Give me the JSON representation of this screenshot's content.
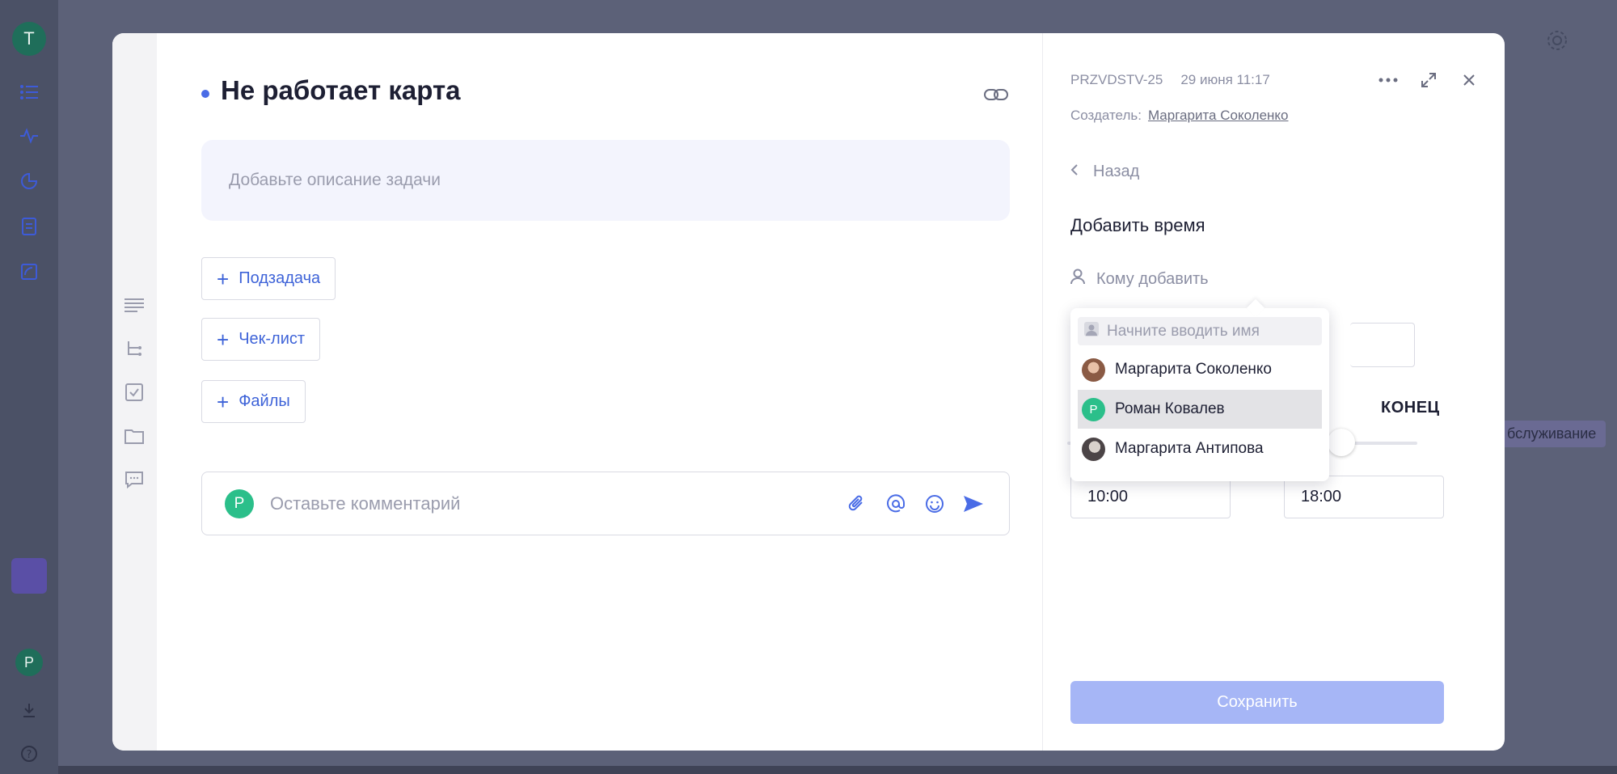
{
  "background": {
    "user_avatar_initial": "Т",
    "bottom_avatar_initial": "Р",
    "chip_text": "бслуживание"
  },
  "task": {
    "title": "Не работает карта",
    "description_placeholder": "Добавьте описание задачи",
    "add_subtask_label": "Подзадача",
    "add_checklist_label": "Чек-лист",
    "add_files_label": "Файлы",
    "comment_avatar_initial": "Р",
    "comment_placeholder": "Оставьте комментарий"
  },
  "details": {
    "task_key": "PRZVDSTV-25",
    "date": "29 июня 11:17",
    "creator_label": "Создатель:",
    "creator_name": "Маргарита Соколенко",
    "back_label": "Назад",
    "section_title": "Добавить время",
    "whom_placeholder": "Кому добавить",
    "end_label": "КОНЕЦ",
    "start_time": "10:00",
    "end_time": "18:00",
    "save_label": "Сохранить"
  },
  "dropdown": {
    "search_placeholder": "Начните вводить имя",
    "items": [
      {
        "name": "Маргарита Соколенко",
        "avatar": "photo"
      },
      {
        "name": "Роман Ковалев",
        "avatar": "initial",
        "initial": "Р"
      },
      {
        "name": "Маргарита Антипова",
        "avatar": "photo"
      }
    ]
  },
  "colors": {
    "accent": "#4a6ce6",
    "save_disabled": "#a6b6f6",
    "avatar_green": "#2bbf8a"
  }
}
